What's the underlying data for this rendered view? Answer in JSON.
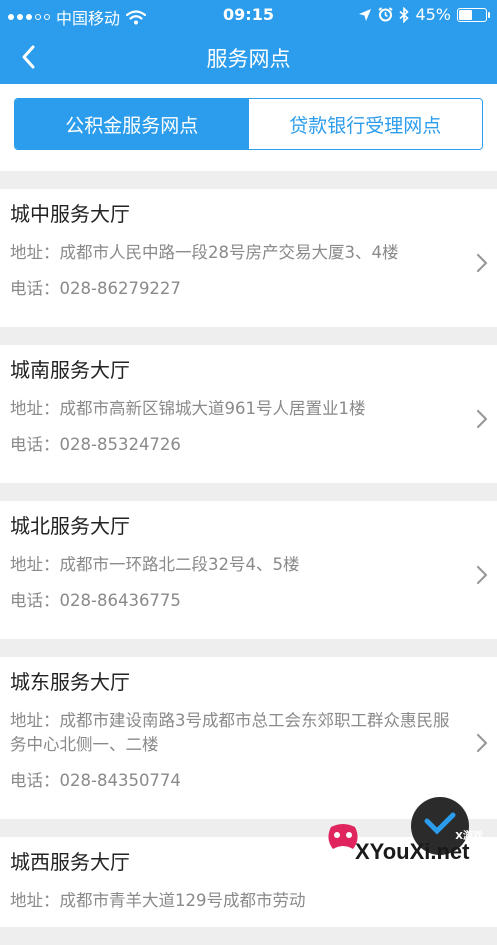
{
  "status_bar": {
    "carrier": "中国移动",
    "time": "09:15",
    "battery_percent": "45%",
    "battery_level": 0.45,
    "icons": [
      "signal-dots-icon",
      "wifi-icon",
      "location-arrow-icon",
      "alarm-icon",
      "bluetooth-icon",
      "battery-icon"
    ]
  },
  "nav": {
    "title": "服务网点",
    "back_icon": "chevron-left-icon"
  },
  "tabs": [
    {
      "label": "公积金服务网点",
      "active": true
    },
    {
      "label": "贷款银行受理网点",
      "active": false
    }
  ],
  "outlets": [
    {
      "name": "城中服务大厅",
      "address": "地址：成都市人民中路一段28号房产交易大厦3、4楼",
      "phone": "电话：028-86279227"
    },
    {
      "name": "城南服务大厅",
      "address": "地址：成都市高新区锦城大道961号人居置业1楼",
      "phone": "电话：028-85324726"
    },
    {
      "name": "城北服务大厅",
      "address": "地址：成都市一环路北二段32号4、5楼",
      "phone": "电话：028-86436775"
    },
    {
      "name": "城东服务大厅",
      "address": "地址：成都市建设南路3号成都市总工会东郊职工群众惠民服务中心北侧一、二楼",
      "phone": "电话：028-84350774"
    },
    {
      "name": "城西服务大厅",
      "address": "地址：成都市青羊大道129号成都市劳动",
      "phone": ""
    }
  ],
  "watermark": {
    "text": "XYouXi.net",
    "small_text": "X游戏"
  },
  "colors": {
    "primary": "#2c9ded",
    "background": "#eeeeee"
  }
}
